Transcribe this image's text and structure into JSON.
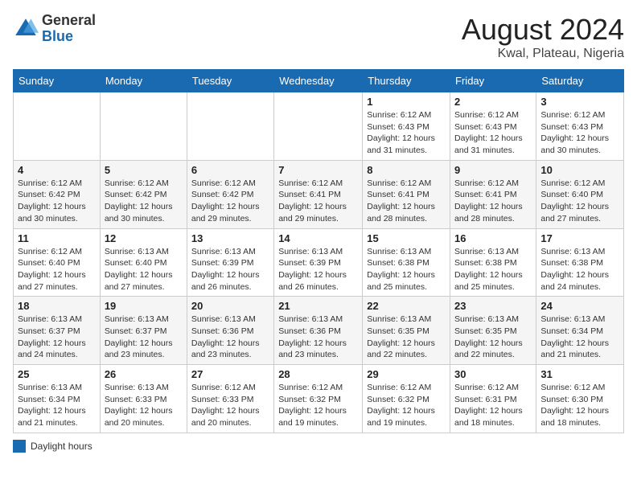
{
  "header": {
    "logo_general": "General",
    "logo_blue": "Blue",
    "main_title": "August 2024",
    "sub_title": "Kwal, Plateau, Nigeria"
  },
  "days_of_week": [
    "Sunday",
    "Monday",
    "Tuesday",
    "Wednesday",
    "Thursday",
    "Friday",
    "Saturday"
  ],
  "weeks": [
    [
      {
        "day": "",
        "info": ""
      },
      {
        "day": "",
        "info": ""
      },
      {
        "day": "",
        "info": ""
      },
      {
        "day": "",
        "info": ""
      },
      {
        "day": "1",
        "info": "Sunrise: 6:12 AM\nSunset: 6:43 PM\nDaylight: 12 hours and 31 minutes."
      },
      {
        "day": "2",
        "info": "Sunrise: 6:12 AM\nSunset: 6:43 PM\nDaylight: 12 hours and 31 minutes."
      },
      {
        "day": "3",
        "info": "Sunrise: 6:12 AM\nSunset: 6:43 PM\nDaylight: 12 hours and 30 minutes."
      }
    ],
    [
      {
        "day": "4",
        "info": "Sunrise: 6:12 AM\nSunset: 6:42 PM\nDaylight: 12 hours and 30 minutes."
      },
      {
        "day": "5",
        "info": "Sunrise: 6:12 AM\nSunset: 6:42 PM\nDaylight: 12 hours and 30 minutes."
      },
      {
        "day": "6",
        "info": "Sunrise: 6:12 AM\nSunset: 6:42 PM\nDaylight: 12 hours and 29 minutes."
      },
      {
        "day": "7",
        "info": "Sunrise: 6:12 AM\nSunset: 6:41 PM\nDaylight: 12 hours and 29 minutes."
      },
      {
        "day": "8",
        "info": "Sunrise: 6:12 AM\nSunset: 6:41 PM\nDaylight: 12 hours and 28 minutes."
      },
      {
        "day": "9",
        "info": "Sunrise: 6:12 AM\nSunset: 6:41 PM\nDaylight: 12 hours and 28 minutes."
      },
      {
        "day": "10",
        "info": "Sunrise: 6:12 AM\nSunset: 6:40 PM\nDaylight: 12 hours and 27 minutes."
      }
    ],
    [
      {
        "day": "11",
        "info": "Sunrise: 6:12 AM\nSunset: 6:40 PM\nDaylight: 12 hours and 27 minutes."
      },
      {
        "day": "12",
        "info": "Sunrise: 6:13 AM\nSunset: 6:40 PM\nDaylight: 12 hours and 27 minutes."
      },
      {
        "day": "13",
        "info": "Sunrise: 6:13 AM\nSunset: 6:39 PM\nDaylight: 12 hours and 26 minutes."
      },
      {
        "day": "14",
        "info": "Sunrise: 6:13 AM\nSunset: 6:39 PM\nDaylight: 12 hours and 26 minutes."
      },
      {
        "day": "15",
        "info": "Sunrise: 6:13 AM\nSunset: 6:38 PM\nDaylight: 12 hours and 25 minutes."
      },
      {
        "day": "16",
        "info": "Sunrise: 6:13 AM\nSunset: 6:38 PM\nDaylight: 12 hours and 25 minutes."
      },
      {
        "day": "17",
        "info": "Sunrise: 6:13 AM\nSunset: 6:38 PM\nDaylight: 12 hours and 24 minutes."
      }
    ],
    [
      {
        "day": "18",
        "info": "Sunrise: 6:13 AM\nSunset: 6:37 PM\nDaylight: 12 hours and 24 minutes."
      },
      {
        "day": "19",
        "info": "Sunrise: 6:13 AM\nSunset: 6:37 PM\nDaylight: 12 hours and 23 minutes."
      },
      {
        "day": "20",
        "info": "Sunrise: 6:13 AM\nSunset: 6:36 PM\nDaylight: 12 hours and 23 minutes."
      },
      {
        "day": "21",
        "info": "Sunrise: 6:13 AM\nSunset: 6:36 PM\nDaylight: 12 hours and 23 minutes."
      },
      {
        "day": "22",
        "info": "Sunrise: 6:13 AM\nSunset: 6:35 PM\nDaylight: 12 hours and 22 minutes."
      },
      {
        "day": "23",
        "info": "Sunrise: 6:13 AM\nSunset: 6:35 PM\nDaylight: 12 hours and 22 minutes."
      },
      {
        "day": "24",
        "info": "Sunrise: 6:13 AM\nSunset: 6:34 PM\nDaylight: 12 hours and 21 minutes."
      }
    ],
    [
      {
        "day": "25",
        "info": "Sunrise: 6:13 AM\nSunset: 6:34 PM\nDaylight: 12 hours and 21 minutes."
      },
      {
        "day": "26",
        "info": "Sunrise: 6:13 AM\nSunset: 6:33 PM\nDaylight: 12 hours and 20 minutes."
      },
      {
        "day": "27",
        "info": "Sunrise: 6:12 AM\nSunset: 6:33 PM\nDaylight: 12 hours and 20 minutes."
      },
      {
        "day": "28",
        "info": "Sunrise: 6:12 AM\nSunset: 6:32 PM\nDaylight: 12 hours and 19 minutes."
      },
      {
        "day": "29",
        "info": "Sunrise: 6:12 AM\nSunset: 6:32 PM\nDaylight: 12 hours and 19 minutes."
      },
      {
        "day": "30",
        "info": "Sunrise: 6:12 AM\nSunset: 6:31 PM\nDaylight: 12 hours and 18 minutes."
      },
      {
        "day": "31",
        "info": "Sunrise: 6:12 AM\nSunset: 6:30 PM\nDaylight: 12 hours and 18 minutes."
      }
    ]
  ],
  "legend": {
    "color_box": "#1a6ab1",
    "label": "Daylight hours"
  }
}
